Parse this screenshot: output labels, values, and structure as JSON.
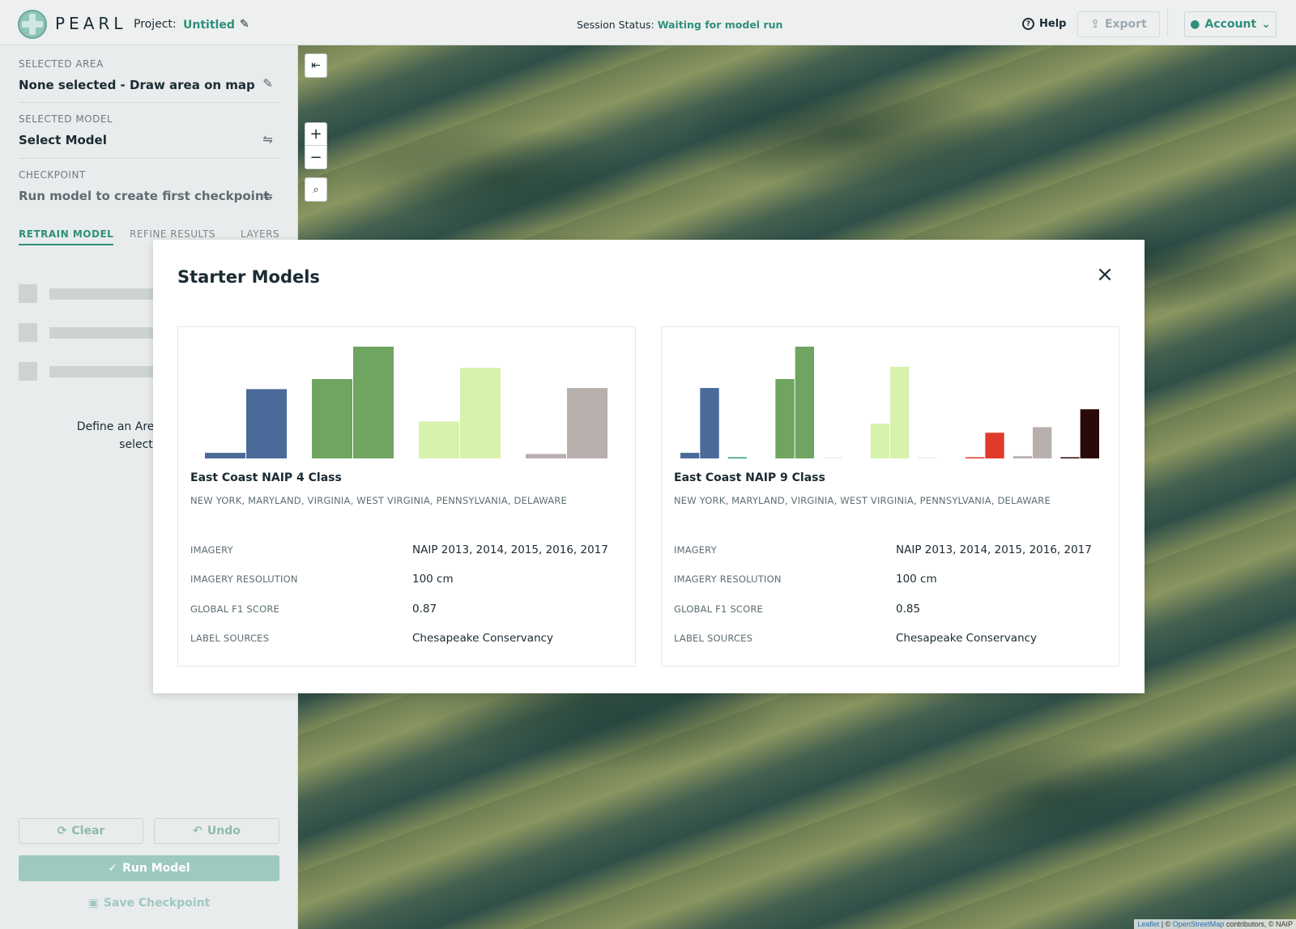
{
  "header": {
    "logo_text": "PEARL",
    "project_label": "Project:",
    "project_name": "Untitled",
    "status_label": "Session Status:",
    "status_value": "Waiting for model run",
    "help_label": "Help",
    "export_label": "Export",
    "account_label": "Account"
  },
  "sidebar": {
    "selected_area": {
      "label": "SELECTED AREA",
      "value": "None selected - Draw area on map"
    },
    "selected_model": {
      "label": "SELECTED MODEL",
      "value": "Select Model"
    },
    "checkpoint": {
      "label": "CHECKPOINT",
      "value": "Run model to create first checkpoint"
    },
    "tabs": [
      {
        "label": "RETRAIN MODEL",
        "active": true
      },
      {
        "label": "REFINE RESULTS",
        "active": false
      },
      {
        "label": "LAYERS",
        "active": false
      }
    ],
    "define_line1": "Define an Area of Interest",
    "define_line2": "selected M",
    "clear_label": "Clear",
    "undo_label": "Undo",
    "run_label": "Run Model",
    "save_label": "Save Checkpoint"
  },
  "map": {
    "zoom_in": "+",
    "zoom_out": "−",
    "attribution_leaflet": "Leaflet",
    "attribution_osm": "OpenStreetMap",
    "attribution_rest": "contributors, © NAIP"
  },
  "modal": {
    "title": "Starter Models",
    "models": [
      {
        "name": "East Coast NAIP 4 Class",
        "regions": "NEW YORK, MARYLAND, VIRGINIA, WEST VIRGINIA, PENNSYLVANIA, DELAWARE",
        "attributes": [
          {
            "label": "IMAGERY",
            "value": "NAIP 2013, 2014, 2015, 2016, 2017"
          },
          {
            "label": "IMAGERY RESOLUTION",
            "value": "100 cm"
          },
          {
            "label": "GLOBAL F1 SCORE",
            "value": "0.87"
          },
          {
            "label": "LABEL SOURCES",
            "value": "Chesapeake Conservancy"
          }
        ]
      },
      {
        "name": "East Coast NAIP 9 Class",
        "regions": "NEW YORK, MARYLAND, VIRGINIA, WEST VIRGINIA, PENNSYLVANIA, DELAWARE",
        "attributes": [
          {
            "label": "IMAGERY",
            "value": "NAIP 2013, 2014, 2015, 2016, 2017"
          },
          {
            "label": "IMAGERY RESOLUTION",
            "value": "100 cm"
          },
          {
            "label": "GLOBAL F1 SCORE",
            "value": "0.85"
          },
          {
            "label": "LABEL SOURCES",
            "value": "Chesapeake Conservancy"
          }
        ]
      }
    ]
  },
  "chart_data": [
    {
      "type": "bar",
      "title": "",
      "ylim": [
        0,
        1
      ],
      "groups": [
        {
          "color": "#4a6a9a",
          "values": [
            0.05,
            0.62
          ]
        },
        {
          "color": "#6fa461",
          "values": [
            0.71,
            1.0
          ]
        },
        {
          "color": "#d6f2ad",
          "values": [
            0.33,
            0.81
          ]
        },
        {
          "color": "#b8b0ad",
          "values": [
            0.04,
            0.63
          ]
        }
      ]
    },
    {
      "type": "bar",
      "title": "",
      "ylim": [
        0,
        1
      ],
      "groups": [
        {
          "color": "#4a6a9a",
          "values": [
            0.05,
            0.63
          ]
        },
        {
          "color": "#2e9a86",
          "values": [
            0.01,
            0.0
          ]
        },
        {
          "color": "#6fa461",
          "values": [
            0.71,
            1.0
          ]
        },
        {
          "color": "#e8ecdf",
          "values": [
            0.01,
            0.0
          ]
        },
        {
          "color": "#d6f2ad",
          "values": [
            0.31,
            0.82
          ]
        },
        {
          "color": "#e8e8e8",
          "values": [
            0.01,
            0.0
          ]
        },
        {
          "color": "#e03a2a",
          "values": [
            0.01,
            0.23
          ]
        },
        {
          "color": "#b8b0ad",
          "values": [
            0.02,
            0.28
          ]
        },
        {
          "color": "#2a0a08",
          "values": [
            0.01,
            0.44
          ]
        }
      ]
    }
  ],
  "colors": {
    "accent": "#2f8f7a",
    "run_button": "#9ec9bf"
  }
}
